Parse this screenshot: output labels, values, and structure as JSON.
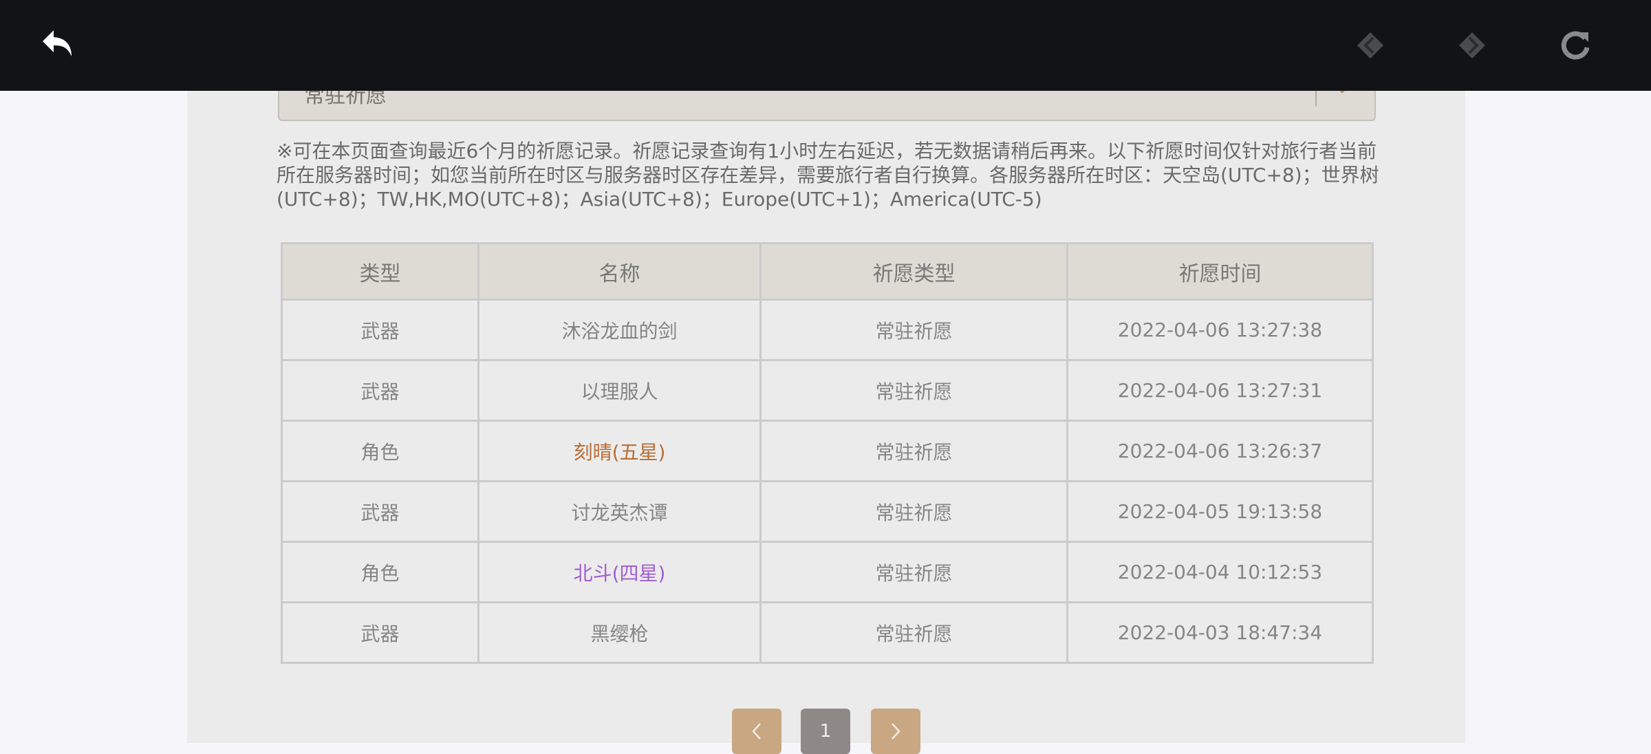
{
  "colors": {
    "five_star": "#b76e37",
    "four_star": "#a05fd0",
    "normal": "#858585"
  },
  "topbar": {
    "back_icon": "back-arrow-icon",
    "icons": [
      "diamond-left-icon",
      "diamond-right-icon",
      "refresh-icon"
    ]
  },
  "filter": {
    "selected": "常驻祈愿"
  },
  "notice": "※可在本页面查询最近6个月的祈愿记录。祈愿记录查询有1小时左右延迟，若无数据请稍后再来。以下祈愿时间仅针对旅行者当前所在服务器时间；如您当前所在时区与服务器时区存在差异，需要旅行者自行换算。各服务器所在时区：天空岛(UTC+8)；世界树(UTC+8)；TW,HK,MO(UTC+8)；Asia(UTC+8)；Europe(UTC+1)；America(UTC-5)",
  "table": {
    "headers": [
      "类型",
      "名称",
      "祈愿类型",
      "祈愿时间"
    ],
    "rows": [
      {
        "type": "武器",
        "name": "沐浴龙血的剑",
        "rarity": "normal",
        "wish": "常驻祈愿",
        "time": "2022-04-06 13:27:38"
      },
      {
        "type": "武器",
        "name": "以理服人",
        "rarity": "normal",
        "wish": "常驻祈愿",
        "time": "2022-04-06 13:27:31"
      },
      {
        "type": "角色",
        "name": "刻晴(五星)",
        "rarity": "five_star",
        "wish": "常驻祈愿",
        "time": "2022-04-06 13:26:37"
      },
      {
        "type": "武器",
        "name": "讨龙英杰谭",
        "rarity": "normal",
        "wish": "常驻祈愿",
        "time": "2022-04-05 19:13:58"
      },
      {
        "type": "角色",
        "name": "北斗(四星)",
        "rarity": "four_star",
        "wish": "常驻祈愿",
        "time": "2022-04-04 10:12:53"
      },
      {
        "type": "武器",
        "name": "黑缨枪",
        "rarity": "normal",
        "wish": "常驻祈愿",
        "time": "2022-04-03 18:47:34"
      }
    ]
  },
  "pagination": {
    "prev_icon": "chevron-left-icon",
    "current_page": "1",
    "next_icon": "chevron-right-icon"
  }
}
